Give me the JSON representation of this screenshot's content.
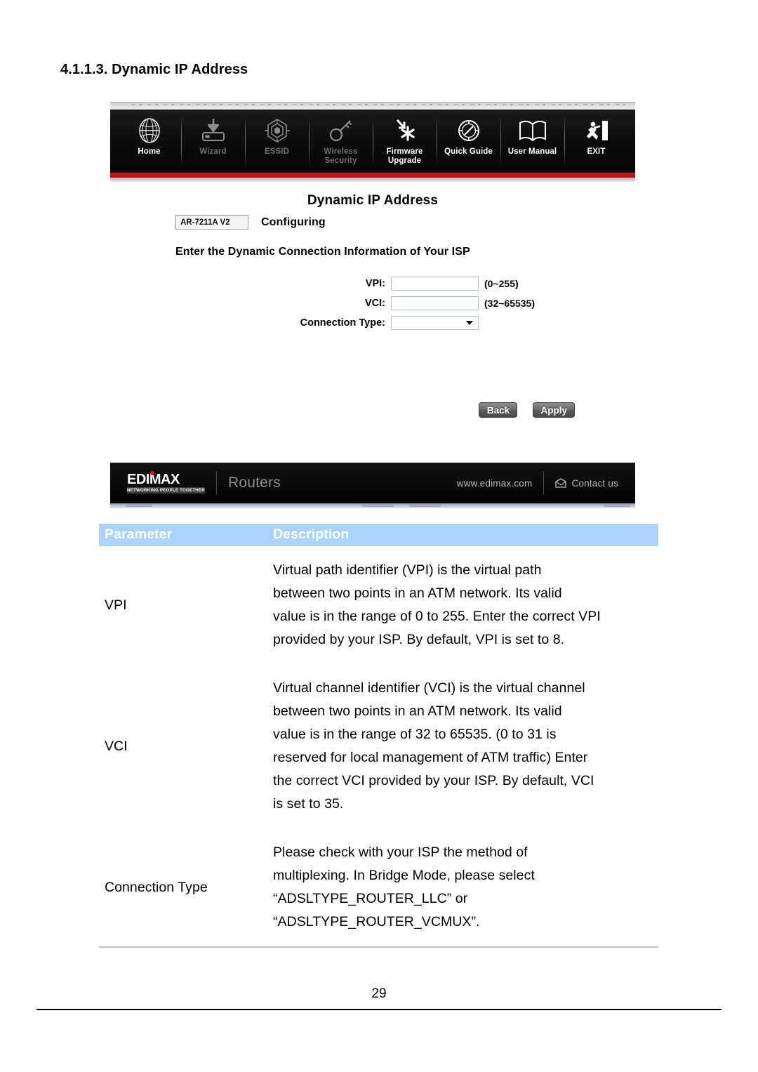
{
  "document": {
    "section_heading": "4.1.1.3. Dynamic IP Address",
    "page_number": "29"
  },
  "router_ui": {
    "nav": [
      {
        "label": "Home",
        "icon": "globe-icon",
        "dimmed": false
      },
      {
        "label": "Wizard",
        "icon": "wizard-install-icon",
        "dimmed": true
      },
      {
        "label": "ESSID",
        "icon": "essid-web-icon",
        "dimmed": true
      },
      {
        "label": "Wireless\nSecurity",
        "label_line1": "Wireless",
        "label_line2": "Security",
        "icon": "key-icon",
        "dimmed": true
      },
      {
        "label": "Firmware\nUpgrade",
        "label_line1": "Firmware",
        "label_line2": "Upgrade",
        "icon": "firmware-upgrade-icon",
        "dimmed": false
      },
      {
        "label": "Quick Guide",
        "icon": "compass-icon",
        "dimmed": false
      },
      {
        "label": "User Manual",
        "icon": "open-book-icon",
        "dimmed": false
      },
      {
        "label": "EXIT",
        "icon": "exit-running-man-icon",
        "dimmed": false
      }
    ],
    "page_title": "Dynamic IP Address",
    "model": "AR-7211A V2",
    "status": "Configuring",
    "instruction": "Enter the Dynamic Connection Information of Your ISP",
    "fields": [
      {
        "label": "VPI:",
        "value": "",
        "hint": "(0~255)",
        "type": "text"
      },
      {
        "label": "VCI:",
        "value": "",
        "hint": "(32~65535)",
        "type": "text"
      },
      {
        "label": "Connection Type:",
        "value": "",
        "hint": "",
        "type": "select"
      }
    ],
    "buttons": {
      "back": "Back",
      "apply": "Apply"
    },
    "footer": {
      "brand": "EDIMAX",
      "tagline": "NETWORKING PEOPLE TOGETHER",
      "category": "Routers",
      "url": "www.edimax.com",
      "contact": "Contact us"
    },
    "colors": {
      "accent_red": "#d8131a",
      "nav_background": "#0a0a0a",
      "table_header": "#a9d4f8"
    }
  },
  "parameter_table": {
    "headers": {
      "parameter": "Parameter",
      "description": "Description"
    },
    "rows": [
      {
        "parameter": "VPI",
        "description_lines": [
          "Virtual path identifier (VPI) is the virtual path",
          "between two points in an ATM network. Its valid",
          "value is in the range of 0 to 255. Enter the correct VPI",
          "provided by your ISP. By default, VPI is set to 8."
        ]
      },
      {
        "parameter": "VCI",
        "description_lines": [
          "Virtual channel identifier (VCI) is the virtual channel",
          "between two points in an ATM network. Its valid",
          "value is in the range of 32 to 65535. (0 to 31 is",
          "reserved for local management of ATM traffic) Enter",
          "the correct VCI provided by your ISP. By default, VCI",
          "is set to 35."
        ]
      },
      {
        "parameter": "Connection Type",
        "description_lines": [
          "Please check with your ISP the method of",
          "multiplexing. In Bridge Mode, please select",
          "“ADSLTYPE_ROUTER_LLC” or",
          "“ADSLTYPE_ROUTER_VCMUX”."
        ]
      }
    ]
  }
}
